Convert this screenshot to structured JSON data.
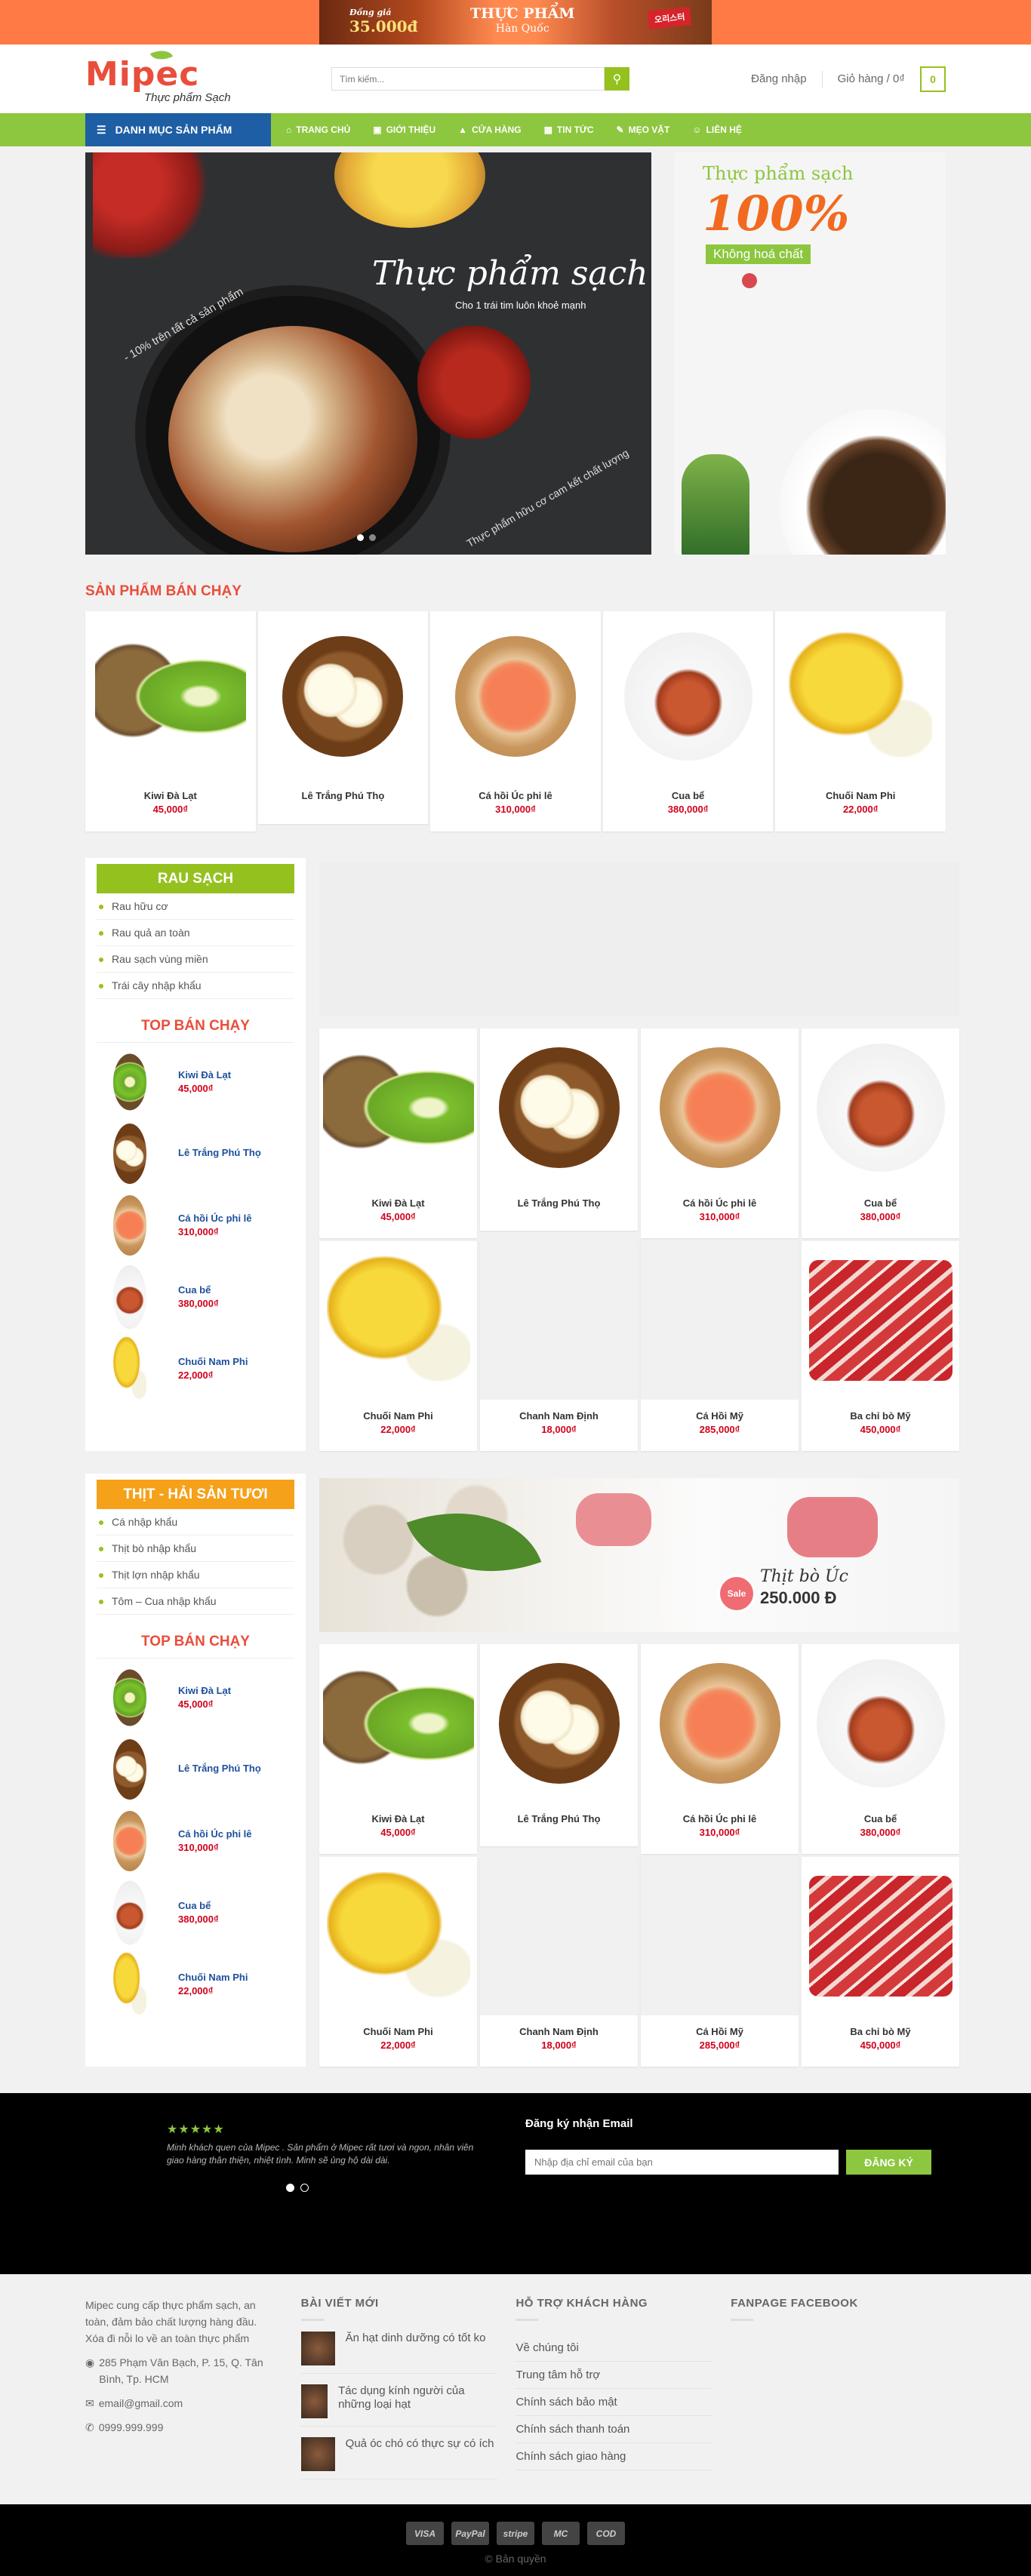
{
  "promo": {
    "deal_price": "35.000đ",
    "deal_label": "Đồng giá",
    "title": "THỰC PHẨM",
    "subtitle": "Hàn Quốc",
    "pack": "오리스터"
  },
  "header": {
    "logo": "Mipec",
    "tagline": "Thực phẩm Sạch",
    "search_placeholder": "Tìm kiếm...",
    "login": "Đăng nhập",
    "cart": "Giỏ hàng / 0₫",
    "cart_count": "0"
  },
  "nav": {
    "category_button": "DANH MỤC SẢN PHẨM",
    "items": [
      "TRANG CHỦ",
      "GIỚI THIỆU",
      "CỬA HÀNG",
      "TIN TỨC",
      "MẸO VẶT",
      "LIÊN HỆ"
    ]
  },
  "hero": {
    "title": "Thực phẩm sạch",
    "subtitle": "Cho 1 trái tim luôn khoẻ mạnh",
    "discount": "- 10% trên tất cả sản phẩm",
    "slogan": "Thực phẩm hữu cơ cam kết chất lượng",
    "side_line1": "Thực phẩm sạch",
    "side_line2": "100%",
    "side_line3": "Không hoá chất"
  },
  "best_sellers": {
    "title": "SẢN PHẨM BÁN CHẠY",
    "items": [
      {
        "name": "Kiwi Đà Lạt",
        "price": "45,000₫"
      },
      {
        "name": "Lê Trắng Phú Thọ",
        "price": ""
      },
      {
        "name": "Cá hồi Úc phi lê",
        "price": "310,000₫"
      },
      {
        "name": "Cua bể",
        "price": "380,000₫"
      },
      {
        "name": "Chuối Nam Phi",
        "price": "22,000₫"
      }
    ]
  },
  "block1": {
    "box_title": "RAU SẠCH",
    "links": [
      "Rau hữu cơ",
      "Rau quả an toàn",
      "Rau sạch vùng miền",
      "Trái cây nhập khẩu"
    ],
    "top_title": "TOP BÁN CHẠY",
    "top_items": [
      {
        "name": "Kiwi Đà Lạt",
        "price": "45,000₫"
      },
      {
        "name": "Lê Trắng Phú Thọ",
        "price": ""
      },
      {
        "name": "Cá hồi Úc phi lê",
        "price": "310,000₫"
      },
      {
        "name": "Cua bể",
        "price": "380,000₫"
      },
      {
        "name": "Chuối Nam Phi",
        "price": "22,000₫"
      }
    ],
    "products": [
      {
        "name": "Kiwi Đà Lạt",
        "price": "45,000₫"
      },
      {
        "name": "Lê Trắng Phú Thọ",
        "price": ""
      },
      {
        "name": "Cá hồi Úc phi lê",
        "price": "310,000₫"
      },
      {
        "name": "Cua bể",
        "price": "380,000₫"
      },
      {
        "name": "Chuối Nam Phi",
        "price": "22,000₫"
      },
      {
        "name": "Chanh Nam Định",
        "price": "18,000₫"
      },
      {
        "name": "Cá Hồi Mỹ",
        "price": "285,000₫"
      },
      {
        "name": "Ba chỉ bò Mỹ",
        "price": "450,000₫"
      }
    ]
  },
  "block2": {
    "box_title": "THỊT - HẢI SẢN TƯƠI",
    "links": [
      "Cá nhập khẩu",
      "Thịt bò nhập khẩu",
      "Thịt lợn nhập khẩu",
      "Tôm – Cua nhập khẩu"
    ],
    "top_title": "TOP BÁN CHẠY",
    "banner_sale": "Sale",
    "banner_title": "Thịt bò Úc",
    "banner_price": "250.000 Đ",
    "top_items": [
      {
        "name": "Kiwi Đà Lạt",
        "price": "45,000₫"
      },
      {
        "name": "Lê Trắng Phú Thọ",
        "price": ""
      },
      {
        "name": "Cá hồi Úc phi lê",
        "price": "310,000₫"
      },
      {
        "name": "Cua bể",
        "price": "380,000₫"
      },
      {
        "name": "Chuối Nam Phi",
        "price": "22,000₫"
      }
    ],
    "products": [
      {
        "name": "Kiwi Đà Lạt",
        "price": "45,000₫"
      },
      {
        "name": "Lê Trắng Phú Thọ",
        "price": ""
      },
      {
        "name": "Cá hồi Úc phi lê",
        "price": "310,000₫"
      },
      {
        "name": "Cua bể",
        "price": "380,000₫"
      },
      {
        "name": "Chuối Nam Phi",
        "price": "22,000₫"
      },
      {
        "name": "Chanh Nam Định",
        "price": "18,000₫"
      },
      {
        "name": "Cá Hồi Mỹ",
        "price": "285,000₫"
      },
      {
        "name": "Ba chỉ bò Mỹ",
        "price": "450,000₫"
      }
    ]
  },
  "testimonial": {
    "stars": "★★★★★",
    "text": "Minh khách quen của Mipec . Sản phẩm ở Mipec rất tươi và ngon, nhân viên giao hàng thân thiện, nhiệt tình. Minh sẽ ủng hộ dài dài."
  },
  "subscribe": {
    "title": "Đăng ký nhận Email",
    "placeholder": "Nhập địa chỉ email của bạn",
    "button": "ĐĂNG KÝ"
  },
  "footer": {
    "about": "Mipec cung cấp thực phẩm sạch, an toàn, đảm bảo chất lượng hàng đầu. Xóa đi nỗi lo về an toàn thực phẩm",
    "address": "285 Phạm Văn Bạch, P. 15, Q. Tân Bình, Tp. HCM",
    "email": "email@gmail.com",
    "phone": "0999.999.999",
    "posts_title": "BÀI VIẾT MỚI",
    "posts": [
      "Ăn hạt dinh dưỡng có tốt ko",
      "Tác dụng kính người của những loại hạt",
      "Quả óc chó có thực sự có ích"
    ],
    "support_title": "HỖ TRỢ KHÁCH HÀNG",
    "support": [
      "Về chúng tôi",
      "Trung tâm hỗ trợ",
      "Chính sách bảo mật",
      "Chính sách thanh toán",
      "Chính sách giao hàng"
    ],
    "fanpage_title": "FANPAGE FACEBOOK",
    "payments": [
      "VISA",
      "PayPal",
      "stripe",
      "MC",
      "COD"
    ],
    "copyright": "© Bản quyền"
  }
}
